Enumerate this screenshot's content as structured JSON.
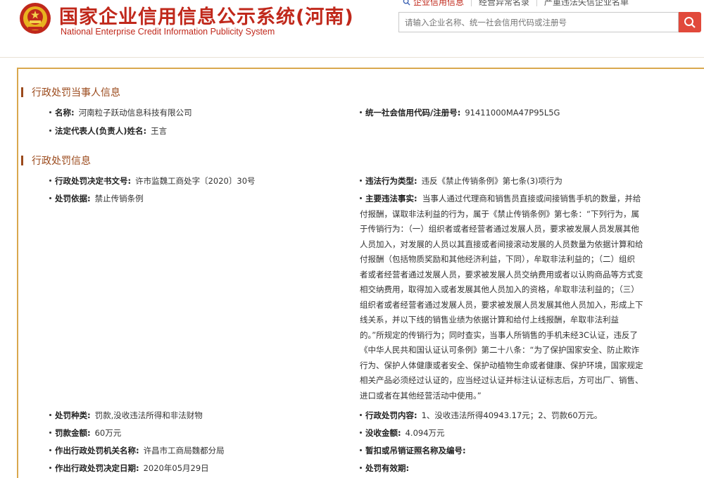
{
  "header": {
    "title_cn": "国家企业信用信息公示系统(河南)",
    "title_en": "National Enterprise Credit Information Publicity System",
    "tabs": [
      "企业信用信息",
      "经营异常名录",
      "严重违法失信企业名单"
    ],
    "search_placeholder": "请输入企业名称、统一社会信用代码或注册号",
    "emblem_icon": "national-emblem-icon",
    "search_icon": "magnifier-icon"
  },
  "section1": {
    "heading": "行政处罚当事人信息",
    "name_label": "名称:",
    "name_value": "河南粒子跃动信息科技有限公司",
    "credit_label": "统一社会信用代码/注册号:",
    "credit_value": "91411000MA47P95L5G",
    "rep_label": "法定代表人(负责人)姓名:",
    "rep_value": "王言"
  },
  "section2": {
    "heading": "行政处罚信息",
    "doc_label": "行政处罚决定书文号:",
    "doc_value": "许市监魏工商处字〔2020〕30号",
    "violation_type_label": "违法行为类型:",
    "violation_type_value": "违反《禁止传销条例》第七条(3)项行为",
    "basis_label": "处罚依据:",
    "basis_value": "禁止传销条例",
    "facts_label": "主要违法事实:",
    "facts_lines": [
      "当事人通过代理商和销售员直接或间接销售手机的数量，并给",
      "付报酬，谋取非法利益的行为，属于《禁止传销条例》第七条：“下列行为，属",
      "于传销行为：（一）组织者或者经营者通过发展人员，要求被发展人员发展其他",
      "人员加入，对发展的人员以其直接或者间接滚动发展的人员数量为依据计算和给",
      "付报酬（包括物质奖励和其他经济利益，下同），牟取非法利益的；（二）组织",
      "者或者经营者通过发展人员，要求被发展人员交纳费用或者以认购商品等方式变",
      "相交纳费用，取得加入或者发展其他人员加入的资格，牟取非法利益的；（三）",
      "组织者或者经营者通过发展人员，要求被发展人员发展其他人员加入，形成上下",
      "线关系，并以下线的销售业绩为依据计算和给付上线报酬，牟取非法利益",
      "的。”所规定的传销行为；同时查实，当事人所销售的手机未经3C认证，违反了",
      "《中华人民共和国认证认可条例》第二十八条：“为了保护国家安全、防止欺诈",
      "行为、保护人体健康或者安全、保护动植物生命或者健康、保护环境，国家规定",
      "相关产品必须经过认证的，应当经过认证并标注认证标志后，方可出厂、销售、",
      "进口或者在其他经营活动中使用。”"
    ],
    "penalty_type_label": "处罚种类:",
    "penalty_type_value": "罚款,没收违法所得和非法财物",
    "penalty_content_label": "行政处罚内容:",
    "penalty_content_value": "1、没收违法所得40943.17元；2、罚款60万元。",
    "fine_label": "罚款金额:",
    "fine_value": "60万元",
    "confiscation_label": "没收金额:",
    "confiscation_value": "4.094万元",
    "authority_label": "作出行政处罚机关名称:",
    "authority_value": "许昌市工商局魏都分局",
    "license_label": "暂扣或吊销证照名称及编号:",
    "date_label": "作出行政处罚决定日期:",
    "date_value": "2020年05月29日",
    "validity_label": "处罚有效期:"
  },
  "colors": {
    "brand_red": "#c0281b",
    "panel_border": "#d9a84e",
    "section_brown": "#9b4a1c",
    "search_button": "#e1493b"
  }
}
